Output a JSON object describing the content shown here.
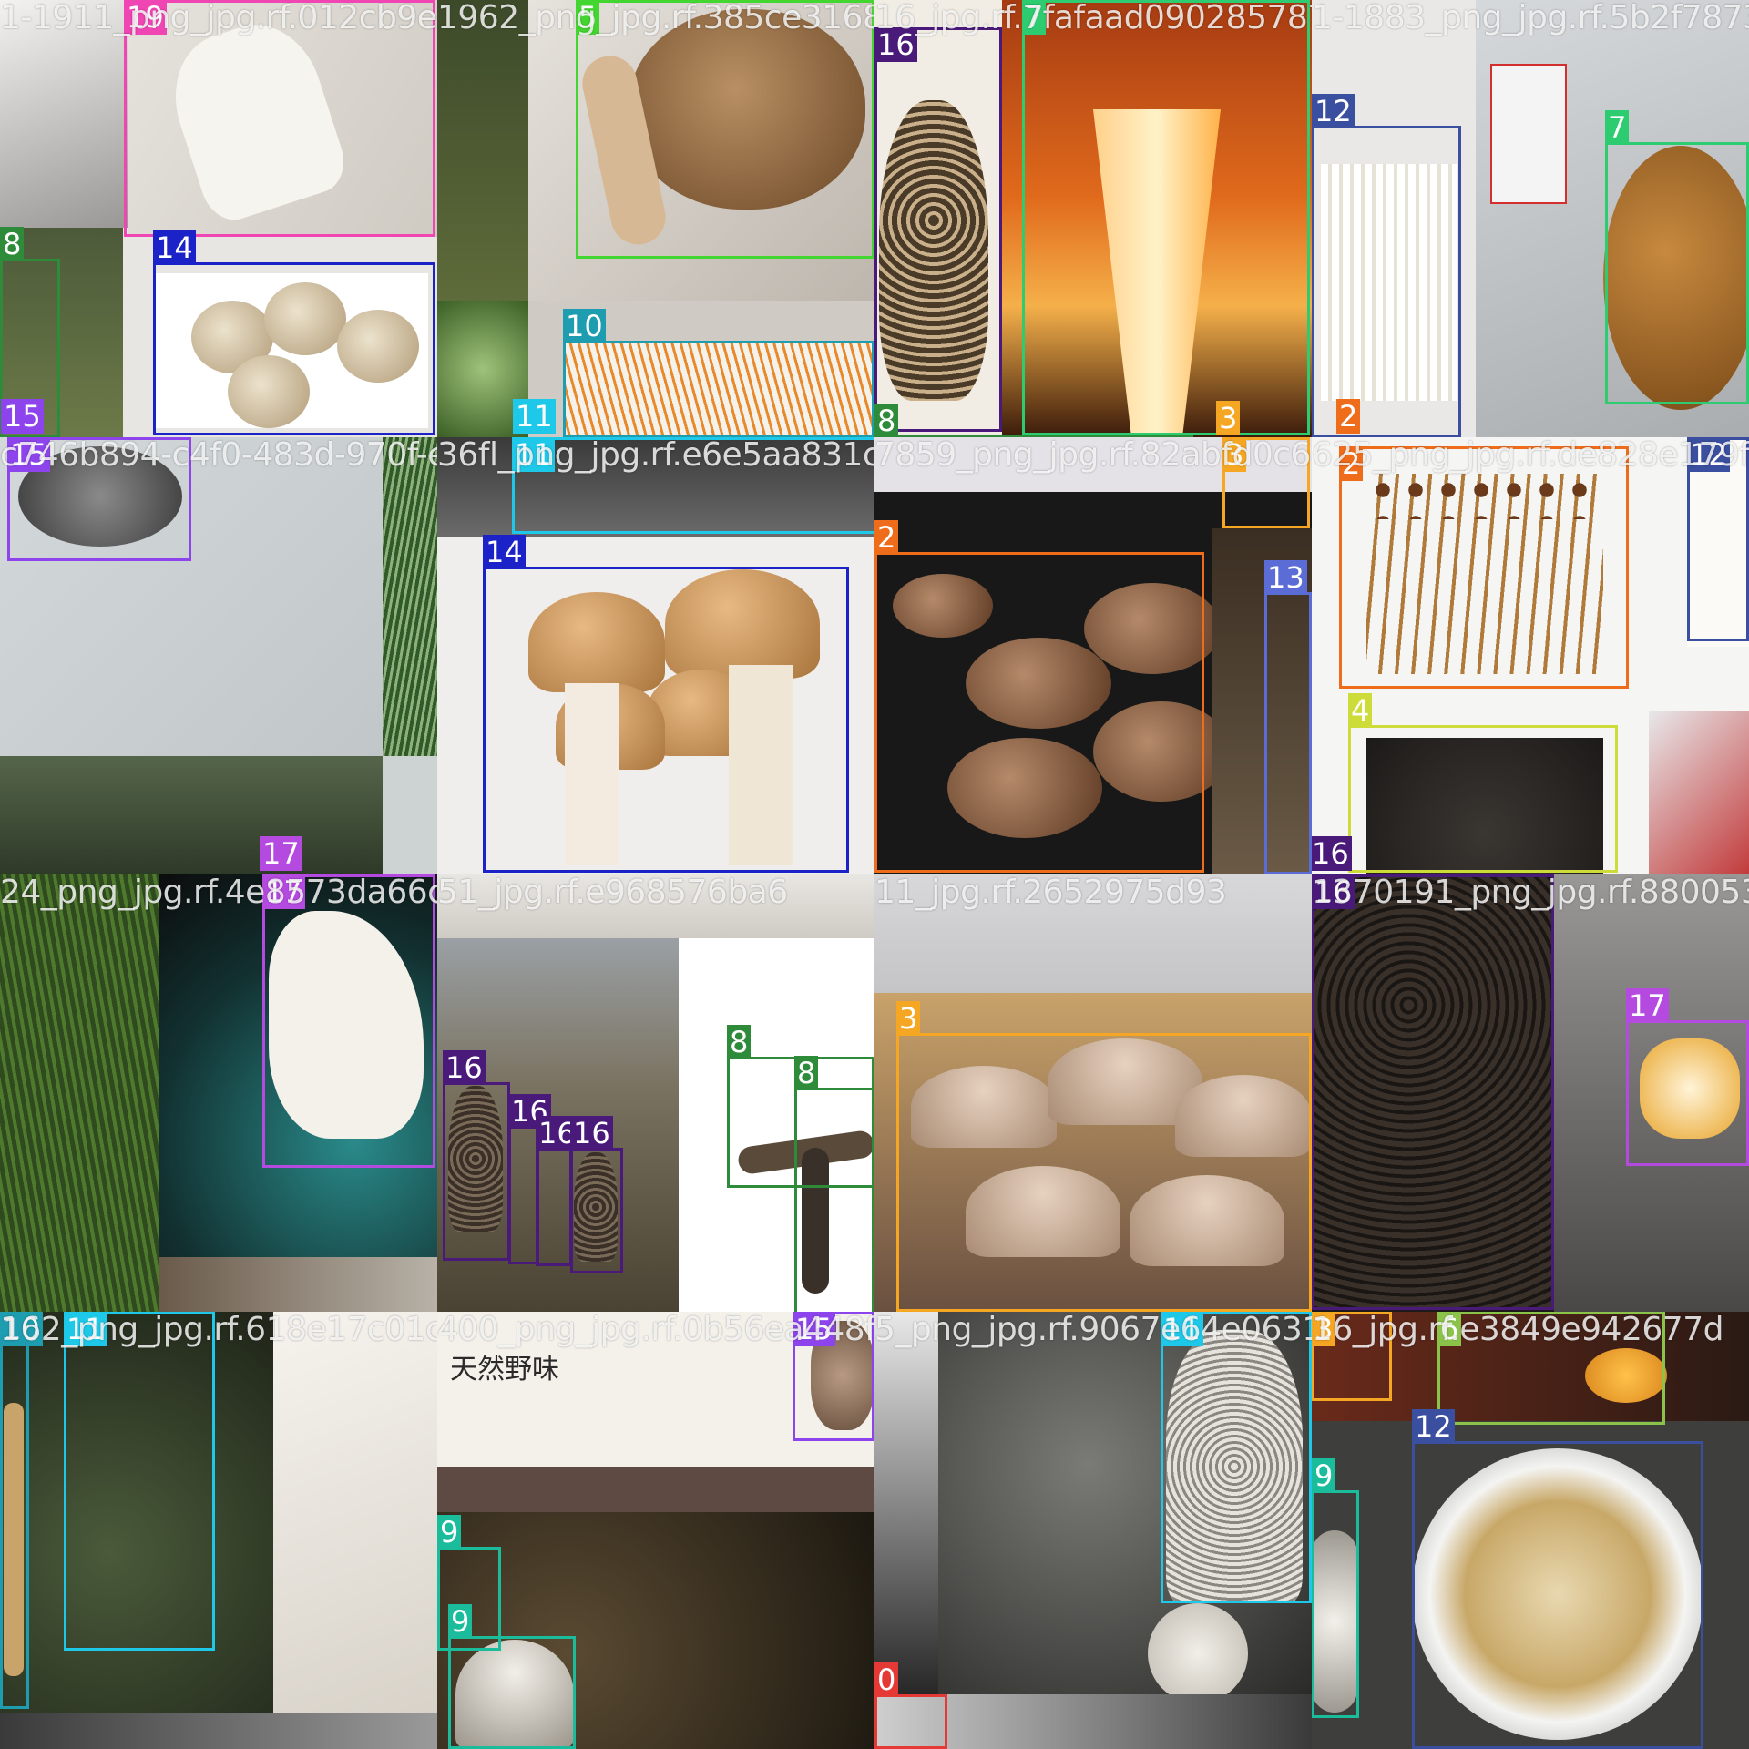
{
  "mosaic": {
    "grid": "4x4",
    "colors": {
      "0": "#e53935",
      "2": "#ef6c1a",
      "3": "#f5a623",
      "4": "#cddc39",
      "5": "#44d630",
      "6": "#8bc34a",
      "7": "#2ecc71",
      "8": "#2e8b3a",
      "9": "#1abc9c",
      "10": "#1e9cb0",
      "11": "#1ec8e8",
      "12": "#3b4fa0",
      "13": "#5b6cd6",
      "14": "#1a22c8",
      "15": "#8e44ec",
      "16": "#4a1a7a",
      "17": "#b44ae0",
      "19": "#f046b4"
    },
    "tiles": [
      {
        "id": "r0c0",
        "filename": "1-1911_png_jpg.rf.012cb9e7",
        "background": "#e8e6e2",
        "subject": "white-king-oyster-and-spotted-button-mushrooms",
        "boxes": [
          {
            "class": "19",
            "color": "#f046b4"
          },
          {
            "class": "14",
            "color": "#1a22c8"
          },
          {
            "class": "8",
            "color": "#2e8b3a"
          },
          {
            "class": "15",
            "color": "#8e44ec"
          }
        ]
      },
      {
        "id": "r0c1",
        "filename": "1962_png_jpg.rf.385ce3168b67",
        "background": "#cfcac4",
        "subject": "brown-mushroom-on-plastic-and-cordyceps",
        "boxes": [
          {
            "class": "5",
            "color": "#44d630"
          },
          {
            "class": "10",
            "color": "#1e9cb0"
          },
          {
            "class": "11",
            "color": "#1ec8e8"
          }
        ]
      },
      {
        "id": "r0c2",
        "filename": "16_jpg.rf.7fafaad090285787",
        "background": "#5a2a10",
        "subject": "orange-chanterelle-and-morel",
        "boxes": [
          {
            "class": "16",
            "color": "#4a1a7a"
          },
          {
            "class": "7",
            "color": "#2ecc71"
          },
          {
            "class": "8",
            "color": "#2e8b3a"
          },
          {
            "class": "3",
            "color": "#f5a623"
          }
        ]
      },
      {
        "id": "r0c3",
        "filename": "1-1883_png_jpg.rf.5b2f78735cc",
        "background": "#cfd3d4",
        "subject": "enoki-and-brown-cap",
        "boxes": [
          {
            "class": "12",
            "color": "#3b4fa0"
          },
          {
            "class": "7",
            "color": "#2ecc71"
          },
          {
            "class": "2",
            "color": "#ef6c1a"
          }
        ]
      },
      {
        "id": "r1c0",
        "filename": "c746b894-c4f0-483d-970f-e5",
        "background": "#cdd2d3",
        "subject": "grey-surface-with-grass",
        "boxes": [
          {
            "class": "15",
            "color": "#8e44ec"
          },
          {
            "class": "17",
            "color": "#b44ae0"
          }
        ]
      },
      {
        "id": "r1c1",
        "filename": "36fl_png_jpg.rf.e6e5aa831cd4",
        "background": "#f0eeec",
        "subject": "brown-capped-king-oyster-bundle",
        "boxes": [
          {
            "class": "14",
            "color": "#1a22c8"
          },
          {
            "class": "11",
            "color": "#1ec8e8"
          }
        ]
      },
      {
        "id": "r1c2",
        "filename": "7859_png_jpg.rf.82abfd0c6",
        "background": "#181818",
        "subject": "brown-oyster-cluster",
        "boxes": [
          {
            "class": "2",
            "color": "#ef6c1a"
          },
          {
            "class": "13",
            "color": "#5b6cd6"
          },
          {
            "class": "3",
            "color": "#f5a623"
          }
        ]
      },
      {
        "id": "r1c3",
        "filename": "625_png_jpg.rf.de828e179fa",
        "background": "#f5f5f4",
        "subject": "tea-tree-mushrooms-and-black-fungus",
        "boxes": [
          {
            "class": "2",
            "color": "#ef6c1a"
          },
          {
            "class": "4",
            "color": "#cddc39"
          },
          {
            "class": "12",
            "color": "#3b4fa0"
          },
          {
            "class": "16",
            "color": "#4a1a7a"
          }
        ]
      },
      {
        "id": "r2c0",
        "filename": "24_png_jpg.rf.4e8573da66c",
        "background": "#233618",
        "subject": "white-mushroom-on-plate-over-grass",
        "boxes": [
          {
            "class": "17",
            "color": "#b44ae0"
          }
        ]
      },
      {
        "id": "r2c1",
        "filename": "51_jpg.rf.e968576ba6",
        "background": "#d7d2c7",
        "subject": "morels-in-greenhouse-and-dark-stems",
        "boxes": [
          {
            "class": "16",
            "color": "#4a1a7a"
          },
          {
            "class": "16",
            "color": "#4a1a7a"
          },
          {
            "class": "16",
            "color": "#4a1a7a"
          },
          {
            "class": "16",
            "color": "#4a1a7a"
          },
          {
            "class": "8",
            "color": "#2e8b3a"
          },
          {
            "class": "8",
            "color": "#2e8b3a"
          }
        ]
      },
      {
        "id": "r2c2",
        "filename": "11_jpg.rf.2652975d93",
        "background": "#c8a878",
        "subject": "brown-button-mushroom-cluster",
        "boxes": [
          {
            "class": "3",
            "color": "#f5a623"
          }
        ]
      },
      {
        "id": "r2c3",
        "filename": "1370191_png_jpg.rf.880053fcb1c",
        "background": "#1f1a1a",
        "subject": "dried-morels-and-yellow-mushroom",
        "boxes": [
          {
            "class": "16",
            "color": "#4a1a7a"
          },
          {
            "class": "17",
            "color": "#b44ae0"
          }
        ]
      },
      {
        "id": "r3c0",
        "filename": "162_png_jpg.rf.618e17c01c",
        "background": "#2c3326",
        "subject": "forest-floor-and-white-mushroom",
        "boxes": [
          {
            "class": "10",
            "color": "#1e9cb0"
          },
          {
            "class": "11",
            "color": "#1ec8e8"
          }
        ]
      },
      {
        "id": "r3c1",
        "filename": "400_png_jpg.rf.0b56ea448f2",
        "background": "#efece6",
        "subject": "chinese-packaging-and-shaggy-ink-caps",
        "headline": "天然野味",
        "boxes": [
          {
            "class": "15",
            "color": "#8e44ec"
          },
          {
            "class": "9",
            "color": "#1abc9c"
          },
          {
            "class": "9",
            "color": "#1abc9c"
          }
        ]
      },
      {
        "id": "r3c2",
        "filename": "5_png_jpg.rf.9067e64e0631",
        "background": "#3a3a38",
        "subject": "bamboo-fungus-net",
        "boxes": [
          {
            "class": "11",
            "color": "#1ec8e8"
          },
          {
            "class": "0",
            "color": "#e53935"
          }
        ]
      },
      {
        "id": "r3c3",
        "filename": "16_jpg.rf.e3849e942677d",
        "background": "#3d3a36",
        "subject": "enoki-bowl-and-chanterelle",
        "boxes": [
          {
            "class": "3",
            "color": "#f5a623"
          },
          {
            "class": "6",
            "color": "#8bc34a"
          },
          {
            "class": "12",
            "color": "#3b4fa0"
          },
          {
            "class": "9",
            "color": "#1abc9c"
          }
        ]
      }
    ]
  }
}
